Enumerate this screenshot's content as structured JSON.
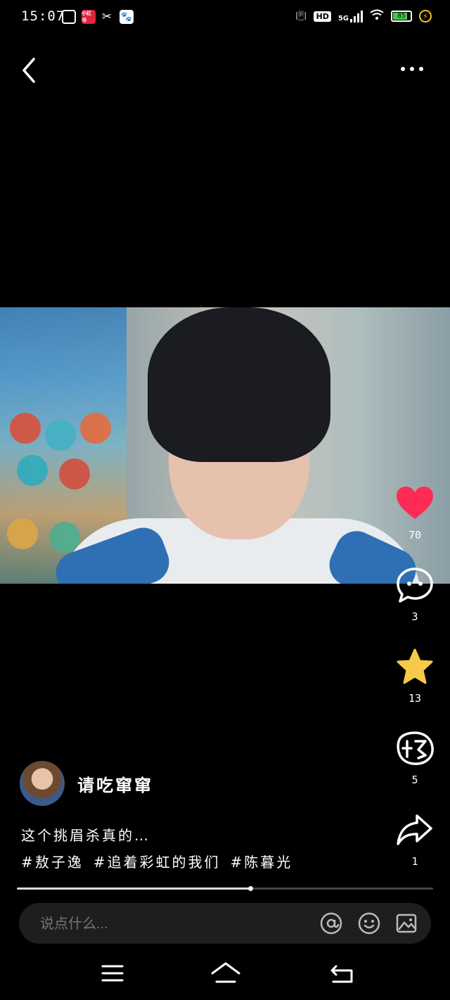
{
  "status_bar": {
    "time": "15:07",
    "apps": [
      "wechat-like-icon",
      "xiaohongshu-icon",
      "capcut-icon",
      "baidu-icon"
    ],
    "app3_label": "小红书",
    "hd": "HD",
    "network": "5G",
    "battery": "85"
  },
  "post": {
    "author_name": "请吃窜窜",
    "caption": "这个挑眉杀真的…",
    "hashtags": [
      "#敖子逸",
      "#追着彩虹的我们",
      "#陈暮光"
    ]
  },
  "actions": {
    "likes": "70",
    "comments": "3",
    "favorites": "13",
    "nice": "5",
    "shares": "1"
  },
  "progress": {
    "played_fraction": 0.56
  },
  "comment_bar": {
    "placeholder": "说点什么..."
  },
  "colors": {
    "like": "#fe2c55",
    "star": "#f7c948",
    "background": "#000000"
  }
}
